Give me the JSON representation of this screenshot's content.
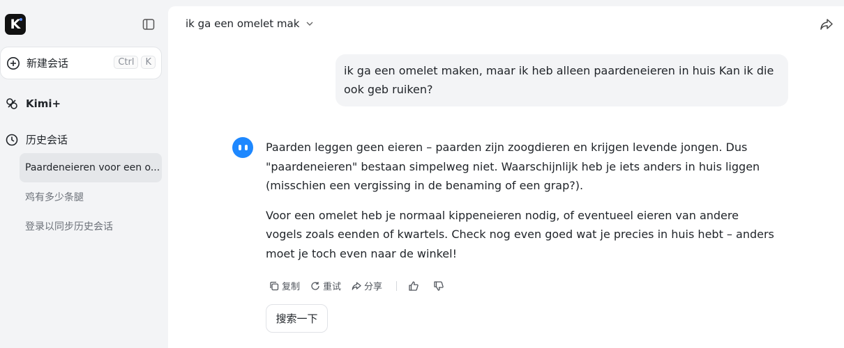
{
  "app": {
    "logo_letter": "K"
  },
  "sidebar": {
    "new_chat_label": "新建会话",
    "shortcut_keys": [
      "Ctrl",
      "K"
    ],
    "kimi_plus_label": "Kimi+",
    "history_label": "历史会话",
    "history_items": [
      {
        "label": "Paardeneieren voor een o..."
      },
      {
        "label": "鸡有多少条腿"
      },
      {
        "label": "登录以同步历史会话"
      }
    ]
  },
  "chat": {
    "title": "ik ga een omelet mak",
    "user_message": "ik ga een omelet maken, maar ik heb alleen paardeneieren in huis Kan ik die ook geb ruiken?",
    "assistant_paragraphs": [
      "Paarden leggen geen eieren – paarden zijn zoogdieren en krijgen levende jongen. Dus \"paardeneieren\" bestaan simpelweg niet. Waarschijnlijk heb je iets anders in huis liggen (misschien een vergissing in de benaming of een grap?).",
      "Voor een omelet heb je normaal kippeneieren nodig, of eventueel eieren van andere vogels zoals eenden of kwartels. Check nog even goed wat je precies in huis hebt – anders moet je toch even naar de winkel!"
    ],
    "actions": {
      "copy": "复制",
      "retry": "重试",
      "share": "分享"
    },
    "search_button": "搜索一下"
  },
  "colors": {
    "avatar": "#1e88ff",
    "sidebar_bg": "#f3f4f6",
    "bubble_bg": "#f3f4f6"
  }
}
